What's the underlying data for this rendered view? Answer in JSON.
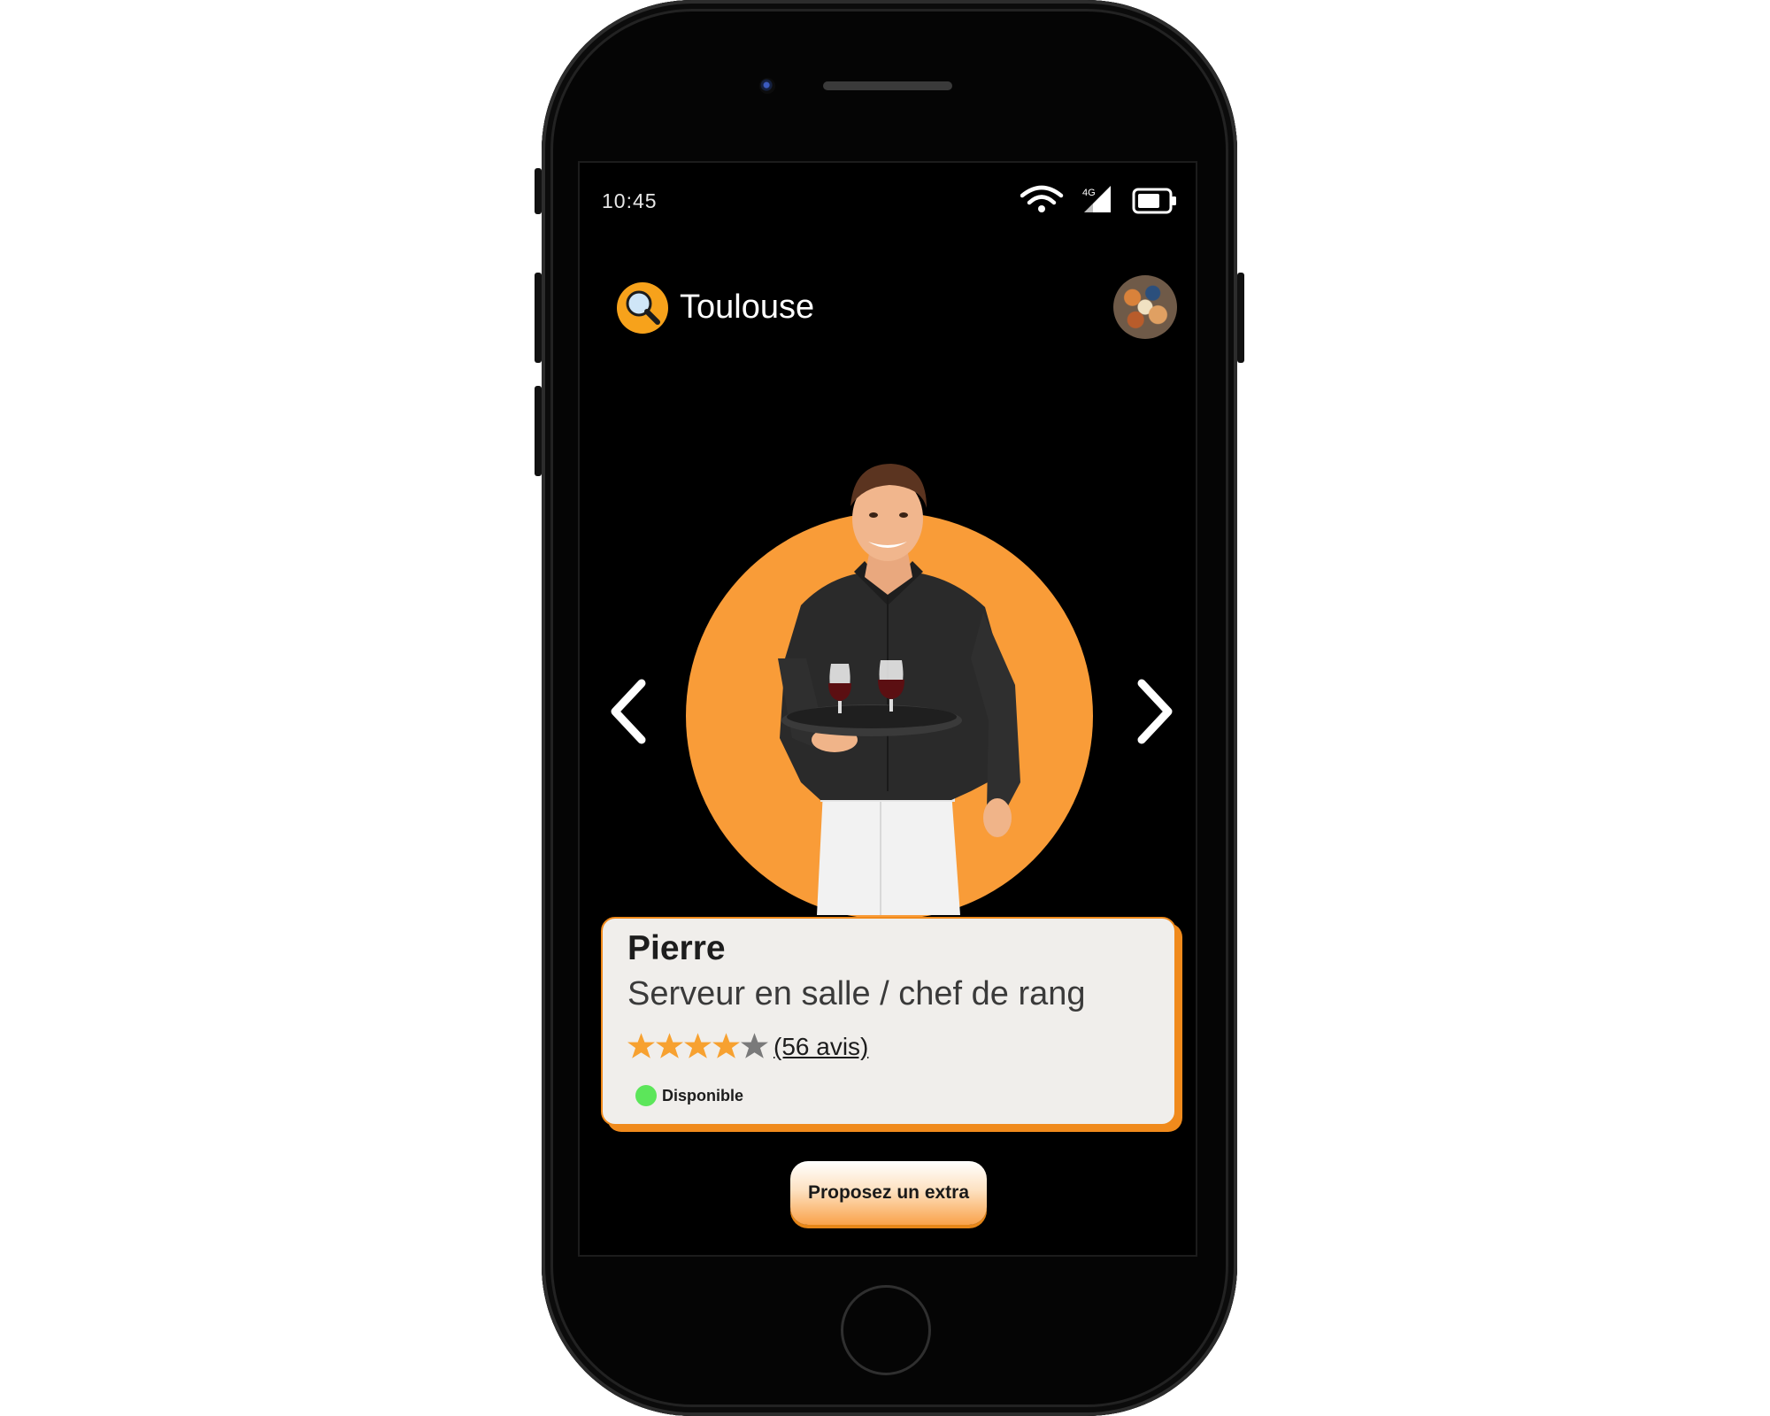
{
  "status_bar": {
    "time": "10:45",
    "network_label": "4G",
    "icons": [
      "wifi-icon",
      "signal-icon",
      "battery-icon"
    ]
  },
  "header": {
    "location": "Toulouse",
    "search_icon": "magnifier-icon",
    "avatar": "profile-avatar"
  },
  "carousel": {
    "prev_icon": "chevron-left-icon",
    "next_icon": "chevron-right-icon"
  },
  "profile_card": {
    "name": "Pierre",
    "role": "Serveur en salle / chef de rang",
    "rating": 4,
    "rating_max": 5,
    "reviews": "(56 avis)",
    "availability": "Disponible"
  },
  "cta": {
    "label": "Proposez un extra"
  },
  "colors": {
    "accent": "#f99c38",
    "accent_dark": "#f08a1c",
    "available": "#5ce65a",
    "star_filled": "#f7a130",
    "star_empty": "#7a7a7a"
  }
}
